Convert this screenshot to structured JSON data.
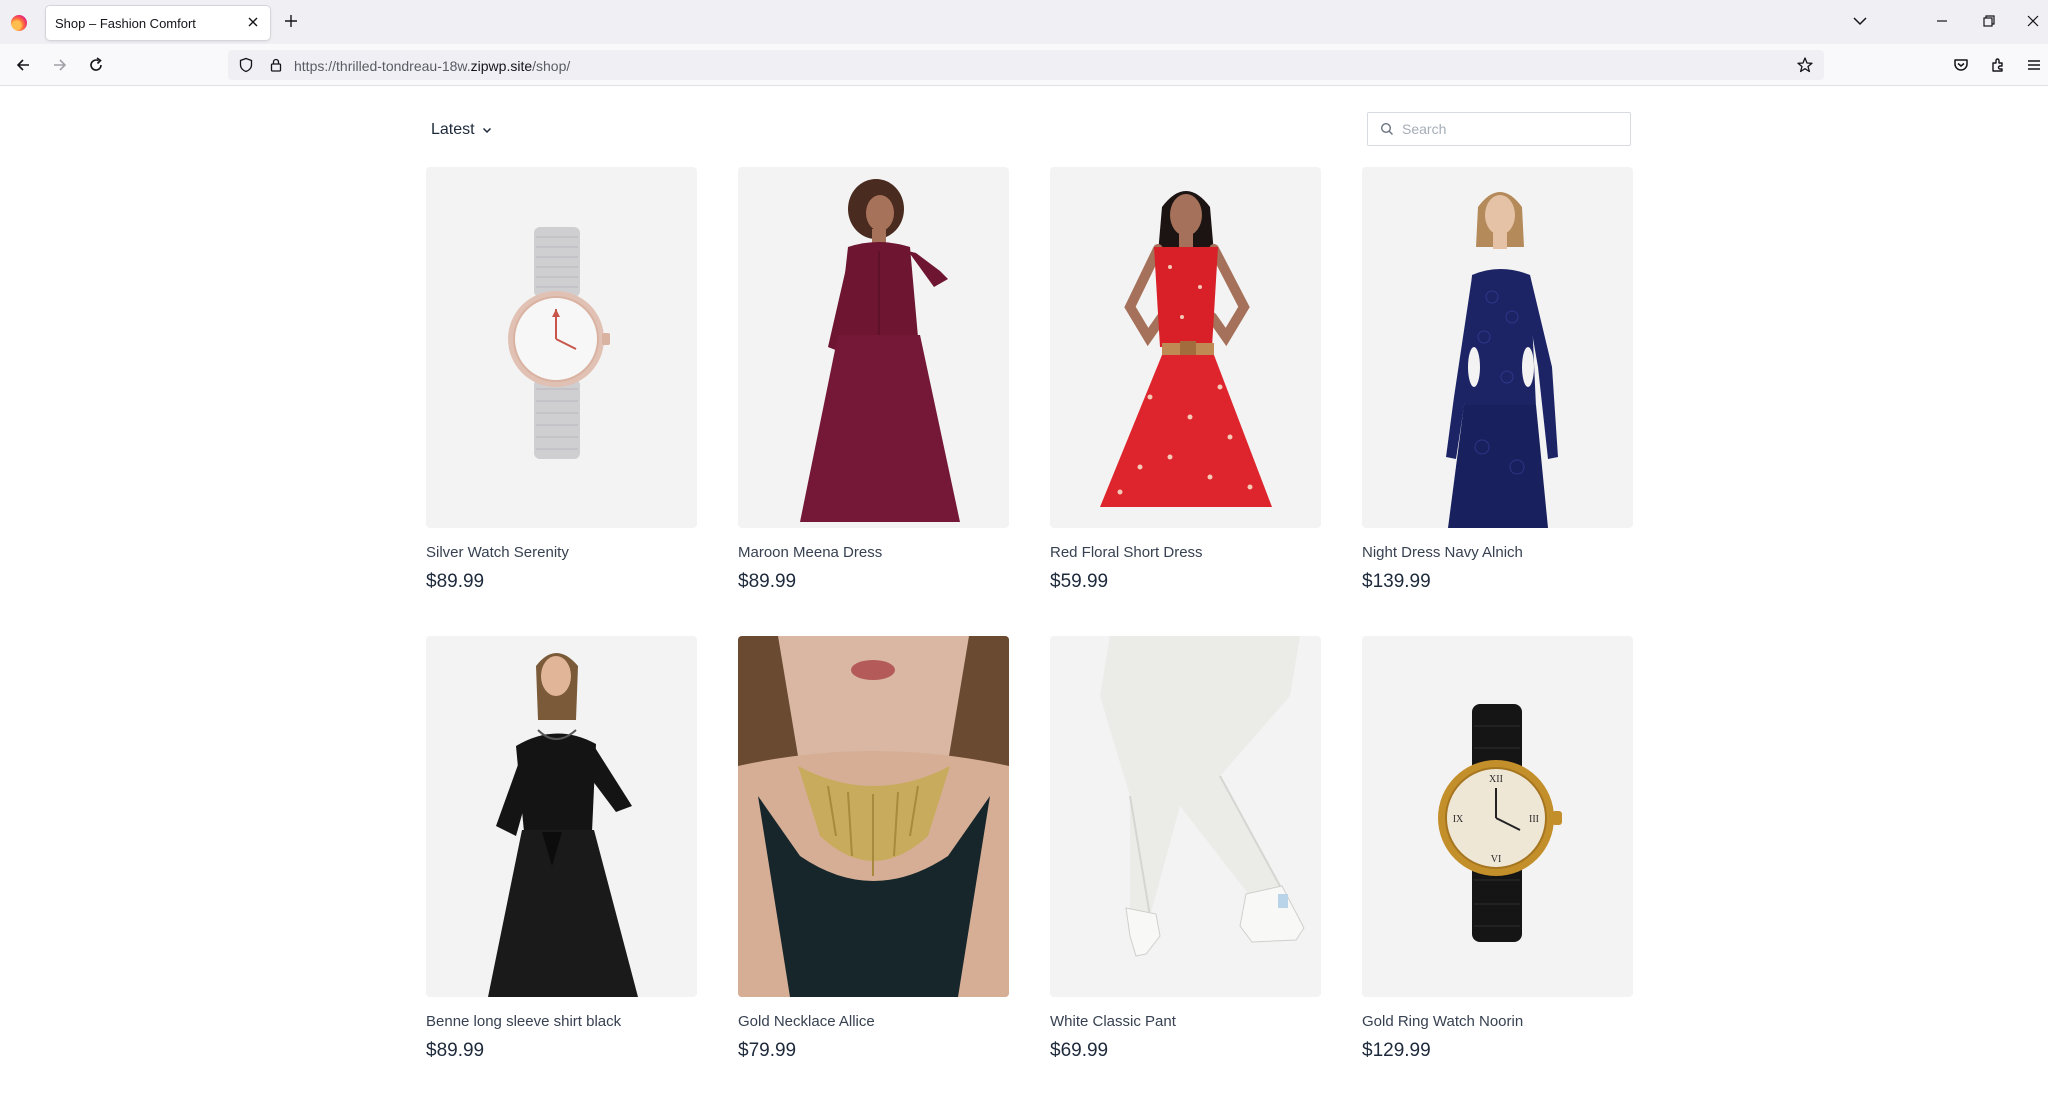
{
  "browser": {
    "tab_title": "Shop – Fashion Comfort",
    "url_prefix": "https://thrilled-tondreau-18w.",
    "url_domain": "zipwp.site",
    "url_path": "/shop/"
  },
  "shop": {
    "sort_label": "Latest",
    "search_placeholder": "Search",
    "products": [
      {
        "name": "Silver Watch Serenity",
        "price": "$89.99",
        "image": "silver-watch"
      },
      {
        "name": "Maroon Meena Dress",
        "price": "$89.99",
        "image": "maroon-dress"
      },
      {
        "name": "Red Floral Short Dress",
        "price": "$59.99",
        "image": "red-floral-dress"
      },
      {
        "name": "Night Dress Navy Alnich",
        "price": "$139.99",
        "image": "navy-lace-dress"
      },
      {
        "name": "Benne long sleeve shirt black",
        "price": "$89.99",
        "image": "black-dress"
      },
      {
        "name": "Gold Necklace Allice",
        "price": "$79.99",
        "image": "gold-necklace"
      },
      {
        "name": "White Classic Pant",
        "price": "$69.99",
        "image": "white-pant"
      },
      {
        "name": "Gold Ring Watch Noorin",
        "price": "$129.99",
        "image": "gold-watch"
      }
    ]
  },
  "colors": {
    "chrome_tabbar": "#f0f0f4",
    "chrome_navbar": "#f9f9fb",
    "product_bg": "#f3f3f3",
    "text_dark": "#1e2a3b"
  }
}
